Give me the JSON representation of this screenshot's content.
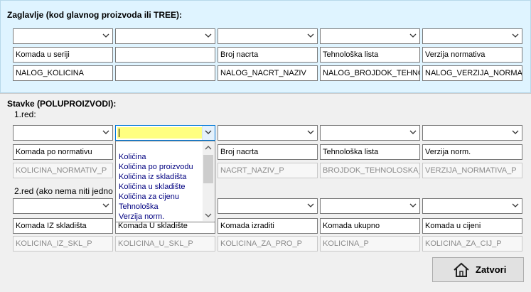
{
  "header": {
    "title": "Zaglavlje (kod glavnog proizvoda ili TREE):",
    "labels": [
      "Komada u seriji",
      "",
      "Broj nacrta",
      "Tehnološka lista",
      "Verzija normativa"
    ],
    "fields": [
      "NALOG_KOLICINA",
      "",
      "NALOG_NACRT_NAZIV",
      "NALOG_BROJDOK_TEHNOL",
      "NALOG_VERZIJA_NORMAT"
    ]
  },
  "stavke": {
    "title": "Stavke (POLUPROIZVODI):",
    "row1_label": "1.red:",
    "row1_labels": [
      "Komada po normativu",
      "",
      "Broj nacrta",
      "Tehnološka lista",
      "Verzija norm."
    ],
    "row1_fields": [
      "KOLICINA_NORMATIV_P",
      "",
      "NACRT_NAZIV_P",
      "BROJDOK_TEHNOLOSKA_P",
      "VERZIJA_NORMATIVA_P"
    ],
    "row2_label": "2.red (ako nema niti jedno",
    "row2_labels": [
      "Komada IZ skladišta",
      "Komada U skladište",
      "Komada izraditi",
      "Komada ukupno",
      "Komada u cijeni"
    ],
    "row2_fields": [
      "KOLICINA_IZ_SKL_P",
      "KOLICINA_U_SKL_P",
      "KOLICINA_ZA_PRO_P",
      "KOLICINA_P",
      "KOLICINA_ZA_CIJ_P"
    ]
  },
  "dropdown": {
    "items": [
      "Količina",
      "Količina po proizvodu",
      "Količina iz skladišta",
      "Količina u skladište",
      "Količina za cijenu",
      "Tehnološka",
      "Verzija norm."
    ]
  },
  "buttons": {
    "close_label": "Zatvori"
  },
  "colors": {
    "header_bg": "#dff4ff",
    "focus_field": "#ffff80",
    "list_text": "#000080"
  },
  "icons": [
    "chevron-down-icon",
    "home-icon",
    "scroll-up-icon",
    "scroll-down-icon"
  ]
}
